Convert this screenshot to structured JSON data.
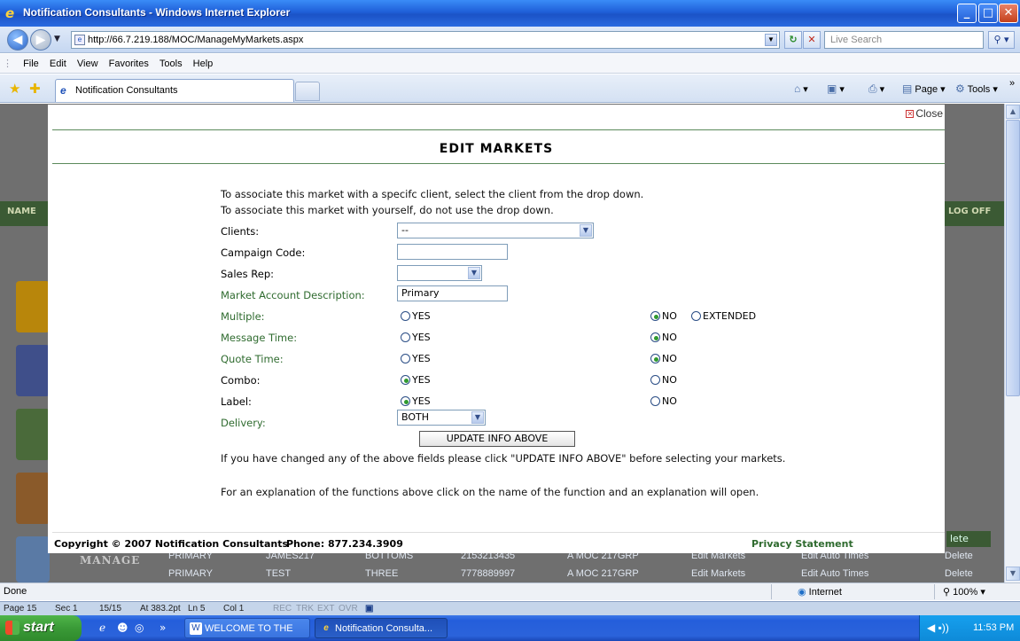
{
  "window": {
    "title": "Notification Consultants - Windows Internet Explorer"
  },
  "address": {
    "url": "http://66.7.219.188/MOC/ManageMyMarkets.aspx",
    "search_placeholder": "Live Search"
  },
  "menu": [
    "File",
    "Edit",
    "View",
    "Favorites",
    "Tools",
    "Help"
  ],
  "tab": {
    "label": "Notification Consultants"
  },
  "commands": {
    "page": "Page",
    "tools": "Tools"
  },
  "background": {
    "name_header": "NAME",
    "logoff": "LOG OFF",
    "right_header": "lete",
    "manage": "MANAGE",
    "rows": [
      [
        "PRIMARY",
        "JAMES217",
        "BOTTOMS",
        "2153213435",
        "A MOC 217GRP",
        "Edit Markets",
        "Edit Auto Times",
        "Delete"
      ],
      [
        "PRIMARY",
        "TEST",
        "THREE",
        "7778889997",
        "A MOC 217GRP",
        "Edit Markets",
        "Edit Auto Times",
        "Delete"
      ]
    ]
  },
  "modal": {
    "close_label": "Close",
    "title": "EDIT MARKETS",
    "intro_line1": "To associate this market with a specifc client, select the client from the drop down.",
    "intro_line2": "To associate this market with yourself, do not use the drop down.",
    "fields": {
      "clients": {
        "label": "Clients:",
        "value": "--"
      },
      "campaign_code": {
        "label": "Campaign Code:",
        "value": ""
      },
      "sales_rep": {
        "label": "Sales Rep:",
        "value": ""
      },
      "market_account_description": {
        "label": "Market Account Description:",
        "value": "Primary"
      },
      "multiple": {
        "label": "Multiple:",
        "options": [
          "YES",
          "NO",
          "EXTENDED"
        ],
        "selected": "NO"
      },
      "message_time": {
        "label": "Message Time:",
        "options": [
          "YES",
          "NO"
        ],
        "selected": "NO"
      },
      "quote_time": {
        "label": "Quote Time:",
        "options": [
          "YES",
          "NO"
        ],
        "selected": "NO"
      },
      "combo": {
        "label": "Combo:",
        "options": [
          "YES",
          "NO"
        ],
        "selected": "YES"
      },
      "label": {
        "label": "Label:",
        "options": [
          "YES",
          "NO"
        ],
        "selected": "YES"
      },
      "delivery": {
        "label": "Delivery:",
        "value": "BOTH"
      }
    },
    "update_button": "UPDATE INFO ABOVE",
    "note1": "If you have changed any of the above fields please click \"UPDATE INFO ABOVE\" before selecting your markets.",
    "note2": "For an explanation of the functions above click on the name of the function and an explanation will open.",
    "footer": {
      "copyright": "Copyright © 2007 Notification Consultants",
      "phone": "Phone: 877.234.3909",
      "privacy": "Privacy Statement"
    }
  },
  "status": {
    "text": "Done",
    "zone": "Internet",
    "zoom": "100%"
  },
  "wordbar": {
    "page": "Page 15",
    "sec": "Sec 1",
    "pages": "15/15",
    "at": "At 383.2pt",
    "ln": "Ln 5",
    "col": "Col 1",
    "rec": "REC",
    "trk": "TRK",
    "ext": "EXT",
    "ovr": "OVR"
  },
  "taskbar": {
    "start": "start",
    "task1": "WELCOME TO THE M...",
    "task2": "Notification Consulta...",
    "clock": "11:53 PM"
  }
}
